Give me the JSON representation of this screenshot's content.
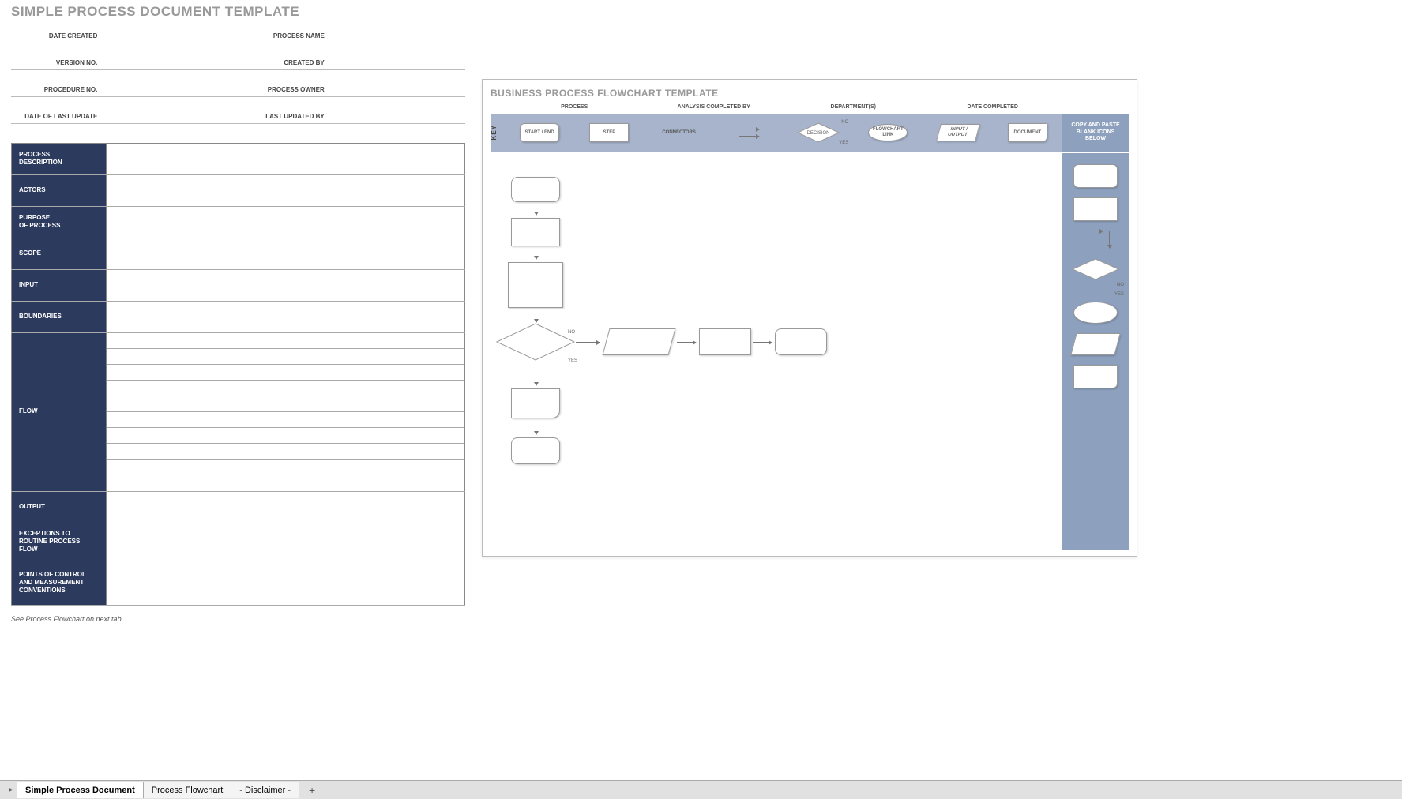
{
  "doc": {
    "title": "SIMPLE PROCESS DOCUMENT TEMPLATE",
    "header_rows": [
      {
        "left": "DATE CREATED",
        "right": "PROCESS NAME"
      },
      {
        "left": "VERSION NO.",
        "right": "CREATED BY"
      },
      {
        "left": "PROCEDURE NO.",
        "right": "PROCESS OWNER"
      },
      {
        "left": "DATE OF LAST UPDATE",
        "right": "LAST UPDATED BY"
      }
    ],
    "sections": [
      {
        "label": "PROCESS\nDESCRIPTION"
      },
      {
        "label": "ACTORS"
      },
      {
        "label": "PURPOSE\nOF PROCESS"
      },
      {
        "label": "SCOPE"
      },
      {
        "label": "INPUT"
      },
      {
        "label": "BOUNDARIES"
      },
      {
        "label": "FLOW",
        "flow_lines": 10
      },
      {
        "label": "OUTPUT"
      },
      {
        "label": "EXCEPTIONS TO\nROUTINE PROCESS FLOW"
      },
      {
        "label": "POINTS OF CONTROL\nAND MEASUREMENT\nCONVENTIONS"
      }
    ],
    "footer_note": "See Process Flowchart on next tab"
  },
  "flowchart": {
    "title": "BUSINESS PROCESS FLOWCHART TEMPLATE",
    "header_cols": [
      "PROCESS",
      "ANALYSIS COMPLETED BY",
      "DEPARTMENT(S)",
      "DATE COMPLETED"
    ],
    "key_label": "KEY",
    "key_items": [
      {
        "name": "start-end",
        "label": "START / END"
      },
      {
        "name": "step",
        "label": "STEP"
      },
      {
        "name": "connectors",
        "label": "CONNECTORS"
      },
      {
        "name": "decision",
        "label": "DECISION",
        "no": "NO",
        "yes": "YES"
      },
      {
        "name": "flowchart-link",
        "label": "FLOWCHART\nLINK"
      },
      {
        "name": "input-output",
        "label": "INPUT /\nOUTPUT"
      },
      {
        "name": "document",
        "label": "DOCUMENT"
      }
    ],
    "palette_label": "COPY AND PASTE BLANK ICONS BELOW",
    "decision_no": "NO",
    "decision_yes": "YES"
  },
  "tabs": {
    "items": [
      {
        "label": "Simple Process Document",
        "active": true
      },
      {
        "label": "Process Flowchart",
        "active": false
      },
      {
        "label": "- Disclaimer -",
        "active": false
      }
    ]
  }
}
